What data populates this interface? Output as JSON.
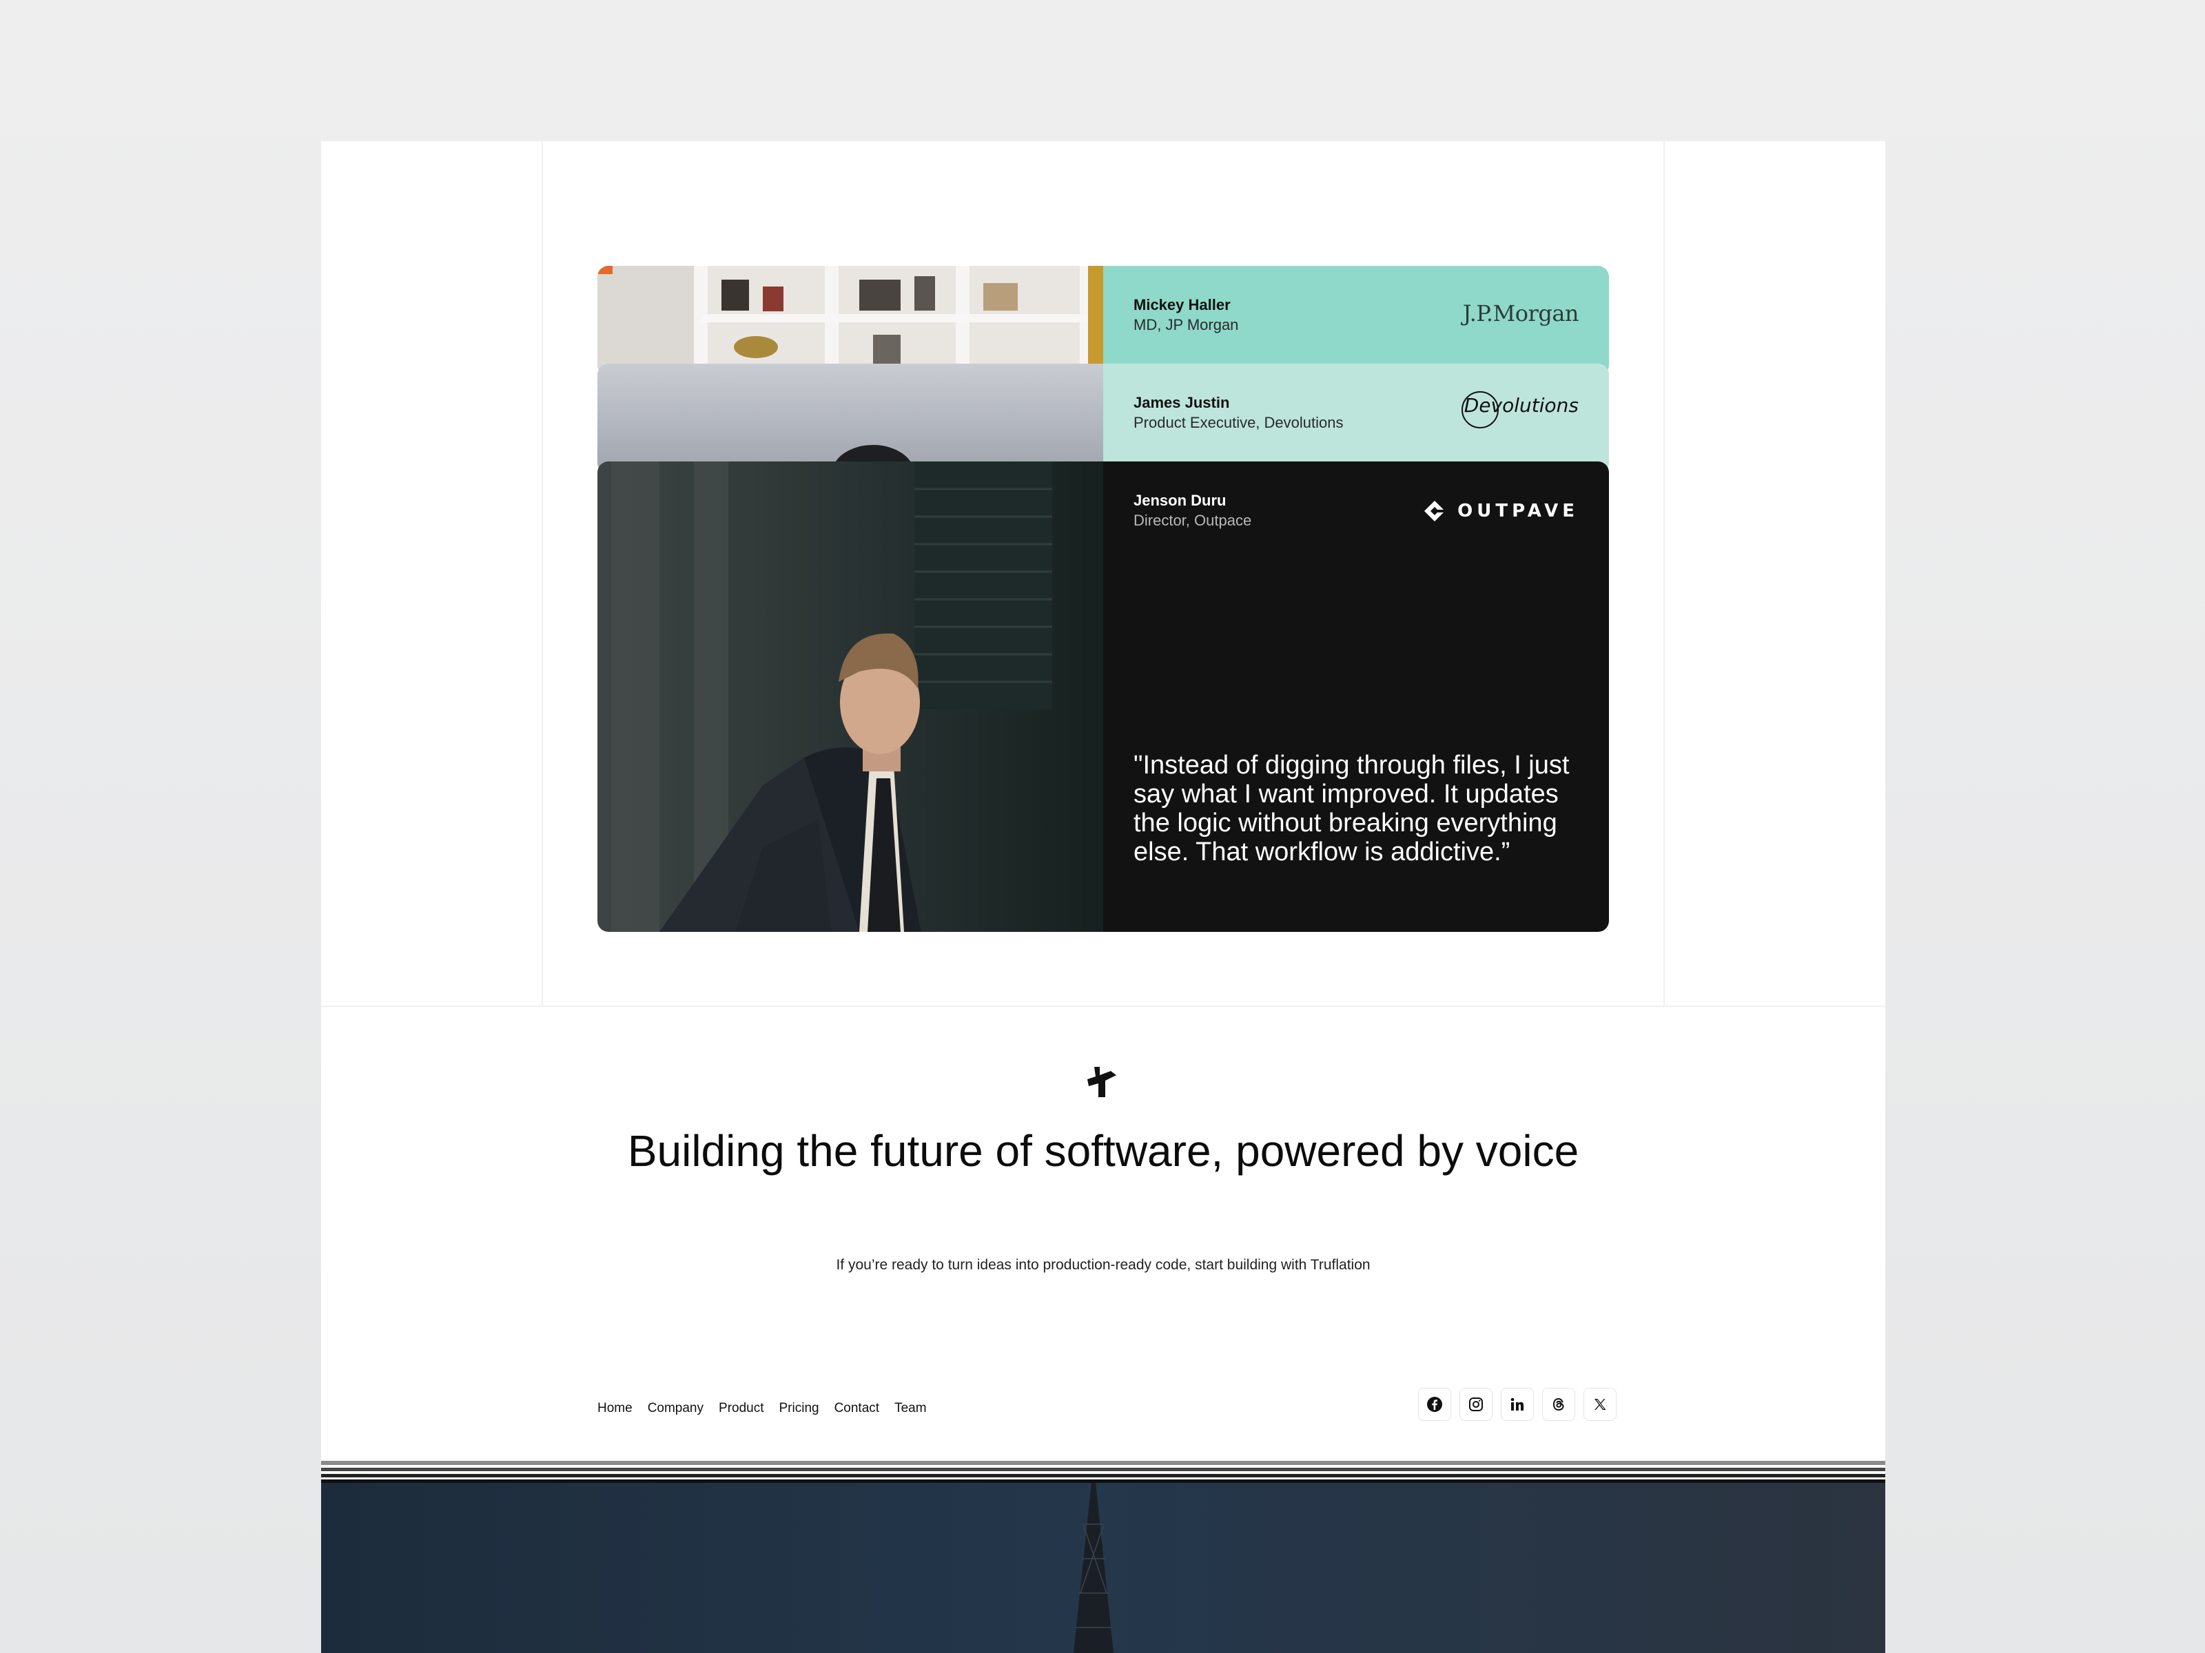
{
  "testimonials": [
    {
      "name": "Mickey Haller",
      "role": "MD, JP Morgan",
      "logo_text": "J.P.Morgan"
    },
    {
      "name": "James Justin",
      "role": "Product Executive, Devolutions",
      "logo_text": "Devolutions"
    },
    {
      "name": "Jenson Duru",
      "role": "Director, Outpace",
      "logo_text": "OUTPAVE",
      "quote": "\"Instead of digging through files, I just say what I want improved. It updates the logic without breaking everything else. That workflow is addictive.”"
    }
  ],
  "cta": {
    "title": "Building the future of software, powered by voice",
    "subtitle": "If you’re ready to turn ideas into production-ready code, start building with Truflation"
  },
  "footer": {
    "nav": [
      "Home",
      "Company",
      "Product",
      "Pricing",
      "Contact",
      "Team"
    ],
    "social": [
      "facebook-icon",
      "instagram-icon",
      "linkedin-icon",
      "threads-icon",
      "x-icon"
    ]
  },
  "colors": {
    "card1_panel": "#8ed9ca",
    "card2_panel": "#bde5dc",
    "card3_panel": "#121212",
    "dark_band": "#24374b"
  }
}
